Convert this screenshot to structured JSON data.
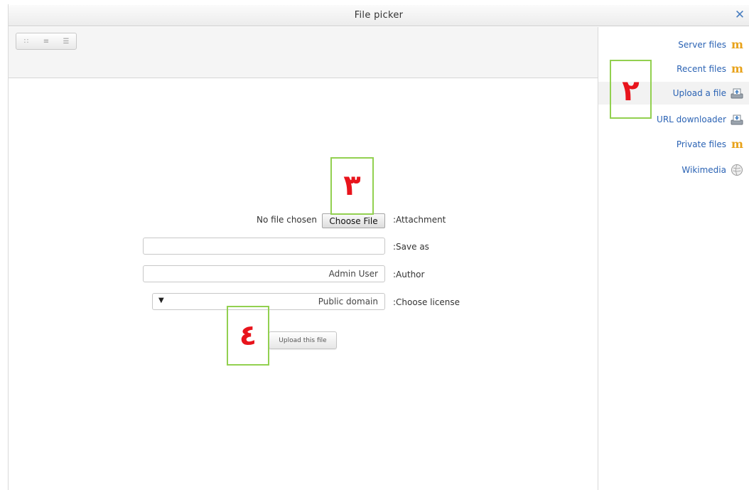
{
  "window": {
    "title": "File picker",
    "close_icon": "close-icon",
    "close_glyph": "✕"
  },
  "toolbar": {
    "view_buttons": [
      {
        "name": "icons-view-button",
        "glyph": "∷"
      },
      {
        "name": "list-view-button",
        "glyph": "≡"
      },
      {
        "name": "tree-view-button",
        "glyph": "☰"
      }
    ]
  },
  "sidebar": {
    "items": [
      {
        "label": "Server files",
        "icon": "moodle-icon",
        "active": false
      },
      {
        "label": "Recent files",
        "icon": "moodle-icon",
        "active": false
      },
      {
        "label": "Upload a file",
        "icon": "upload-icon",
        "active": true
      },
      {
        "label": "URL downloader",
        "icon": "download-icon",
        "active": false
      },
      {
        "label": "Private files",
        "icon": "moodle-icon",
        "active": false
      },
      {
        "label": "Wikimedia",
        "icon": "wikimedia-globe-icon",
        "active": false
      }
    ]
  },
  "form": {
    "attachment": {
      "status": "No file chosen",
      "button": "Choose File",
      "label": ":Attachment"
    },
    "save_as": {
      "value": "",
      "label": ":Save as"
    },
    "author": {
      "value": "Admin User",
      "label": ":Author"
    },
    "license": {
      "value": "Public domain",
      "arrow": "▼",
      "label": ":Choose license"
    },
    "upload_button": "Upload this file"
  },
  "annotations": [
    {
      "id": "marker-2",
      "number": "٢"
    },
    {
      "id": "marker-3",
      "number": "٣"
    },
    {
      "id": "marker-4",
      "number": "٤"
    }
  ],
  "colors": {
    "link": "#2b63b4",
    "marker_border": "#92d050",
    "marker_number": "#e8141c",
    "moodle_icon": "#e8a21a"
  }
}
